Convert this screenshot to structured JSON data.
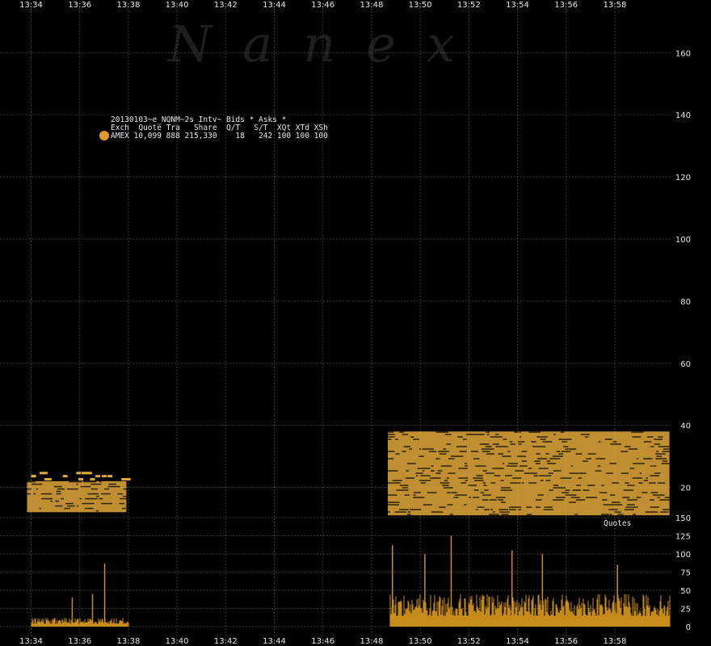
{
  "watermark": "Nanex",
  "info": {
    "title": "20130103~e_NQNM~2s Intv~ Bids * Asks *",
    "header": "Exch  Quote Tra   Share  Q/T   S/T  XQt XTd XSh",
    "row": "AMEX 10,099 888 215,330    18   242 100 100 100",
    "marker_color": "#e39a2a"
  },
  "colors": {
    "background": "#000000",
    "quotes": "#e0a83a",
    "volume": "#c98d1c",
    "grid": "#3c3c3c",
    "text": "#e6e6e6"
  },
  "chart_data": [
    {
      "type": "scatter",
      "name": "Quotes",
      "series_label": "Quotes",
      "x_ticks": [
        "13:34",
        "13:36",
        "13:38",
        "13:40",
        "13:42",
        "13:44",
        "13:46",
        "13:48",
        "13:50",
        "13:52",
        "13:54",
        "13:56",
        "13:58"
      ],
      "y_ticks": [
        20,
        40,
        60,
        80,
        100,
        120,
        140,
        160
      ],
      "ylim": [
        10,
        165
      ],
      "grid": true,
      "segments": [
        {
          "x_start": "13:33:50",
          "x_end": "13:37:55",
          "y_min": 12,
          "y_max": 22,
          "sparse_above": [
            23,
            24,
            25
          ]
        },
        {
          "x_start": "13:48:40",
          "x_end": "13:60:15",
          "y_min": 11,
          "y_max": 38
        }
      ]
    },
    {
      "type": "bar",
      "name": "Volume",
      "y_ticks": [
        0,
        25,
        50,
        75,
        100,
        125,
        150
      ],
      "ylim": [
        0,
        150
      ],
      "segments": [
        {
          "x_start": "13:34:00",
          "x_end": "13:38:00",
          "baseline": 8,
          "peaks": [
            {
              "x": "13:37:00",
              "y": 87
            },
            {
              "x": "13:36:30",
              "y": 45
            },
            {
              "x": "13:35:40",
              "y": 40
            }
          ]
        },
        {
          "x_start": "13:48:45",
          "x_end": "13:60:15",
          "baseline": 30,
          "peaks": [
            {
              "x": "13:48:50",
              "y": 112
            },
            {
              "x": "13:51:15",
              "y": 125
            },
            {
              "x": "13:50:10",
              "y": 100
            },
            {
              "x": "13:53:45",
              "y": 105
            },
            {
              "x": "13:55:00",
              "y": 100
            },
            {
              "x": "13:58:05",
              "y": 85
            }
          ]
        }
      ]
    }
  ]
}
